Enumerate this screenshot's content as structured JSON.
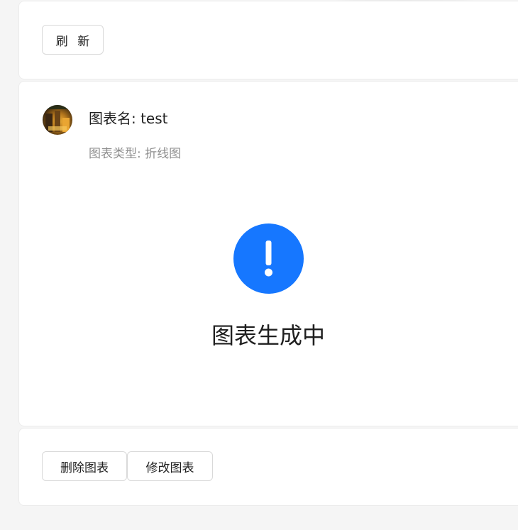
{
  "toolbar": {
    "refresh_label": "刷 新"
  },
  "chart_card": {
    "name_line": "图表名: test",
    "type_line": "图表类型: 折线图",
    "status_title": "图表生成中",
    "status_icon": "exclamation-circle-icon",
    "status_color": "#1677ff"
  },
  "actions": {
    "delete_label": "删除图表",
    "edit_label": "修改图表"
  }
}
